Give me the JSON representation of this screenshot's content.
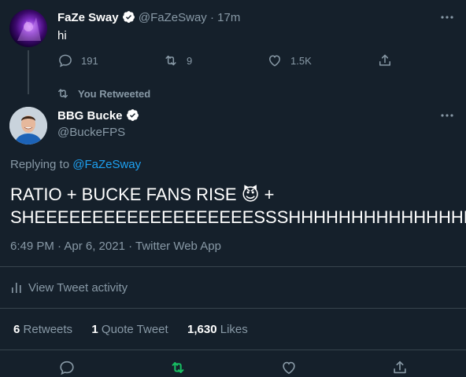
{
  "parent": {
    "display_name": "FaZe Sway",
    "handle": "@FaZeSway",
    "time": "· 17m",
    "text": "hi",
    "replies": "191",
    "retweets": "9",
    "likes": "1.5K"
  },
  "retweet_banner": "You Retweeted",
  "main": {
    "display_name": "BBG Bucke",
    "handle": "@BuckeFPS",
    "replying_prefix": "Replying to",
    "replying_to": "@FaZeSway",
    "text_line1": "RATIO + BUCKE FANS RISE 😈 +",
    "text_line2": "SHEEEEEEEEEEEEEEEEEEESSSHHHHHHHHHHHHHHHH",
    "timestamp": "6:49 PM · Apr 6, 2021 · Twitter Web App",
    "activity_label": "View Tweet activity",
    "retweet_count": "6",
    "retweet_label": "Retweets",
    "quote_count": "1",
    "quote_label": "Quote Tweet",
    "like_count": "1,630",
    "like_label": "Likes"
  },
  "colors": {
    "background": "#15202b",
    "accent": "#1da1f2",
    "retweet_active": "#17bf63",
    "muted": "#8899a6",
    "divider": "#38444d"
  },
  "icons": [
    "more-icon",
    "verified-icon",
    "reply-icon",
    "retweet-icon",
    "like-icon",
    "share-icon",
    "analytics-icon"
  ]
}
